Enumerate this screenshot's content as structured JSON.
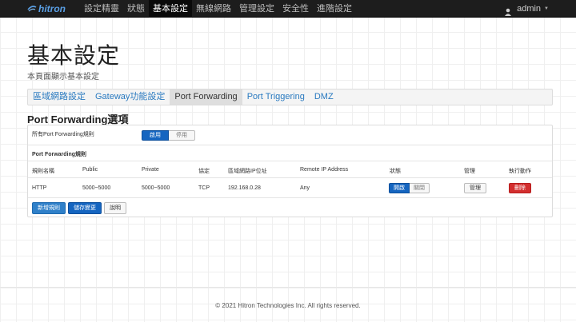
{
  "navbar": {
    "brand": "hitron",
    "items": [
      {
        "label": "設定精靈"
      },
      {
        "label": "狀態"
      },
      {
        "label": "基本設定"
      },
      {
        "label": "無線網路"
      },
      {
        "label": "管理設定"
      },
      {
        "label": "安全性"
      },
      {
        "label": "進階設定"
      }
    ],
    "active_index": 2,
    "user": "admin"
  },
  "page": {
    "title": "基本設定",
    "subtitle": "本頁面顯示基本設定"
  },
  "tabs": [
    {
      "label": "區域網路設定"
    },
    {
      "label": "Gateway功能設定"
    },
    {
      "label": "Port Forwarding"
    },
    {
      "label": "Port Triggering"
    },
    {
      "label": "DMZ"
    }
  ],
  "section": {
    "title": "Port Forwarding選項",
    "all_rules_label": "所有Port Forwarding規則",
    "enable_label": "啟用",
    "disable_label": "停用",
    "rules_heading": "Port Forwarding規則"
  },
  "table": {
    "headers": [
      "規則名稱",
      "Public",
      "Private",
      "協定",
      "區域網路IP位址",
      "Remote IP Address",
      "狀態",
      "管理",
      "執行動作"
    ],
    "rows": [
      {
        "name": "HTTP",
        "public": "5000~5000",
        "private": "5000~5000",
        "protocol": "TCP",
        "lan_ip": "192.168.0.28",
        "remote_ip": "Any",
        "status_on": "開啟",
        "status_off": "關閉",
        "manage": "管理",
        "delete": "刪除"
      }
    ]
  },
  "actions": {
    "add": "新增規則",
    "save": "儲存變更",
    "help": "說明"
  },
  "footer": {
    "copyright": "© 2021 Hitron Technologies Inc.  All rights reserved."
  },
  "colors": {
    "primary": "#1565c0",
    "danger": "#d32f2f",
    "navbar": "#1d1d1d",
    "link": "#2a7ac0"
  }
}
